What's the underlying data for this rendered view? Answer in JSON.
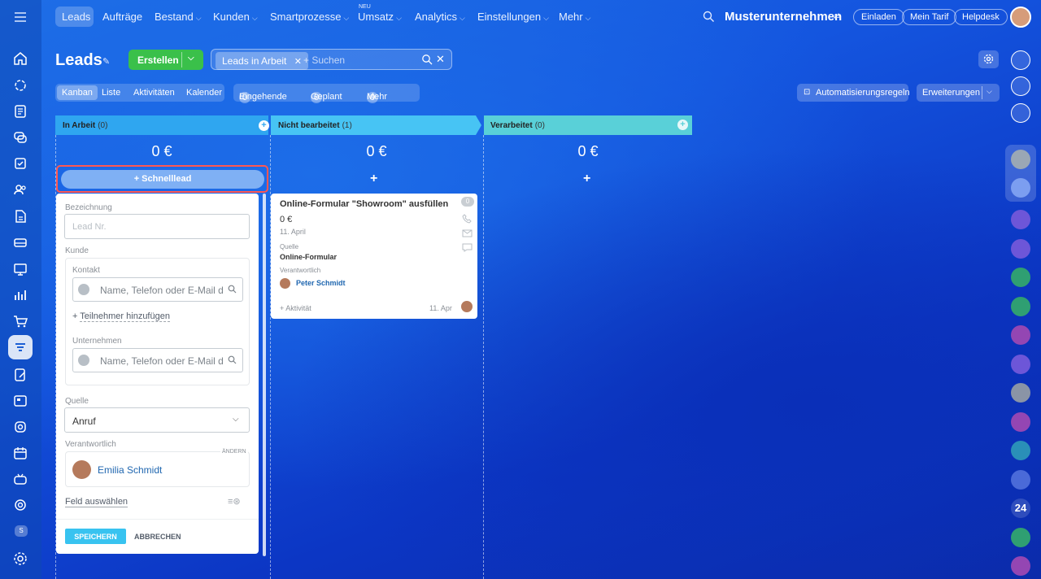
{
  "top_nav": {
    "items": [
      "Leads",
      "Aufträge",
      "Bestand",
      "Kunden",
      "Smartprozesse",
      "Umsatz",
      "Analytics",
      "Einstellungen",
      "Mehr"
    ],
    "new_badge": "NEU",
    "company": "Musterunternehmen",
    "invite": "Einladen",
    "my_plan": "Mein Tarif",
    "helpdesk": "Helpdesk"
  },
  "page": {
    "title": "Leads",
    "create_button": "Erstellen",
    "filter_tag": "Leads in Arbeit",
    "search_placeholder": "+ Suchen"
  },
  "view_tabs": [
    "Kanban",
    "Liste",
    "Aktivitäten",
    "Kalender"
  ],
  "counters": [
    {
      "count": "0",
      "label": "Eingehende"
    },
    {
      "count": "0",
      "label": "Geplant"
    },
    {
      "count": "0",
      "label": "Mehr"
    }
  ],
  "toolbar_right": {
    "automation": "Automatisierungsregeln",
    "extensions": "Erweiterungen"
  },
  "columns": [
    {
      "title": "In Arbeit",
      "count": "(0)",
      "sum": "0 €",
      "color": "#2fa6f0"
    },
    {
      "title": "Nicht bearbeitet",
      "count": "(1)",
      "sum": "0 €",
      "color": "#47c4f4"
    },
    {
      "title": "Verarbeitet",
      "count": "(0)",
      "sum": "0 €",
      "color": "#59d0d8"
    }
  ],
  "quick_lead_button": "Schnelllead",
  "form": {
    "name_label": "Bezeichnung",
    "name_placeholder": "Lead Nr.",
    "client_label": "Kunde",
    "contact_label": "Kontakt",
    "contact_placeholder": "Name, Telefon oder E-Mail de",
    "add_participant": "Teilnehmer hinzufügen",
    "company_label": "Unternehmen",
    "company_placeholder": "Name, Telefon oder E-Mail de",
    "source_label": "Quelle",
    "source_value": "Anruf",
    "responsible_label": "Verantwortlich",
    "change": "ÄNDERN",
    "responsible_name": "Emilia Schmidt",
    "select_field": "Feld auswählen",
    "save": "SPEICHERN",
    "cancel": "ABBRECHEN"
  },
  "lead_card": {
    "title": "Online-Formular \"Showroom\" ausfüllen",
    "badge": "0",
    "amount": "0 €",
    "date": "11. April",
    "source_label": "Quelle",
    "source_value": "Online-Formular",
    "responsible_label": "Verantwortlich",
    "responsible_name": "Peter Schmidt",
    "activity": "+ Aktivität",
    "activity_date": "11. Apr"
  },
  "right_sidebar": {
    "counter": "24"
  },
  "colors": {
    "accent_green": "#3ac04a",
    "link_blue": "#2067b0",
    "save_button": "#38c3f0",
    "highlight_red": "#ff5752"
  }
}
